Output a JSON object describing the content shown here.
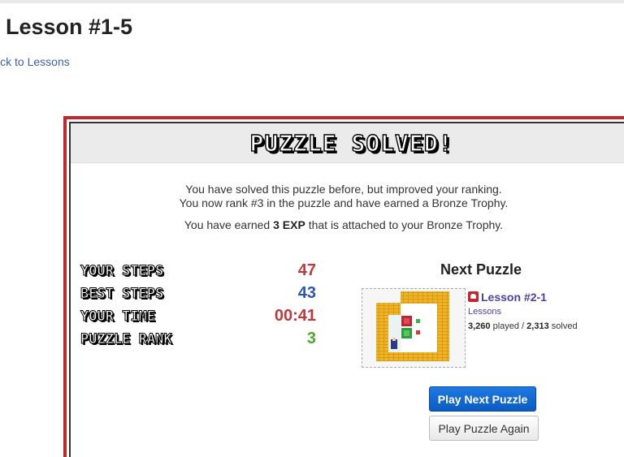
{
  "page": {
    "title": "Lesson #1-5",
    "back_link": "Back to Lessons"
  },
  "modal": {
    "banner_title": "PUZZLE SOLVED!",
    "message_line1": "You have solved this puzzle before, but improved your ranking.",
    "message_line2": "You now rank #3 in the puzzle and have earned a Bronze Trophy.",
    "exp_prefix": "You have earned ",
    "exp_value": "3 EXP",
    "exp_suffix": " that is attached to your Bronze Trophy."
  },
  "stats": [
    {
      "label": "YOUR STEPS",
      "value": "47",
      "color": "#c0393b"
    },
    {
      "label": "BEST STEPS",
      "value": "43",
      "color": "#2f55b0"
    },
    {
      "label": "YOUR TIME",
      "value": "00:41",
      "color": "#c0393b"
    },
    {
      "label": "PUZZLE RANK",
      "value": "3",
      "color": "#4caa2c"
    }
  ],
  "next_puzzle": {
    "heading": "Next Puzzle",
    "lesson_name": "Lesson #2-1",
    "category": "Lessons",
    "played_count": "3,260",
    "played_label": " played / ",
    "solved_count": "2,313",
    "solved_label": " solved",
    "badge_icon": "lesson-badge-icon",
    "thumbnail_icon": "puzzle-thumbnail"
  },
  "buttons": {
    "play_next": "Play Next Puzzle",
    "play_again": "Play Puzzle Again"
  },
  "colors": {
    "modal_border": "#c3262c",
    "primary_button": "#1770d8",
    "link": "#3b5fb5",
    "wall": "#f0b429"
  }
}
